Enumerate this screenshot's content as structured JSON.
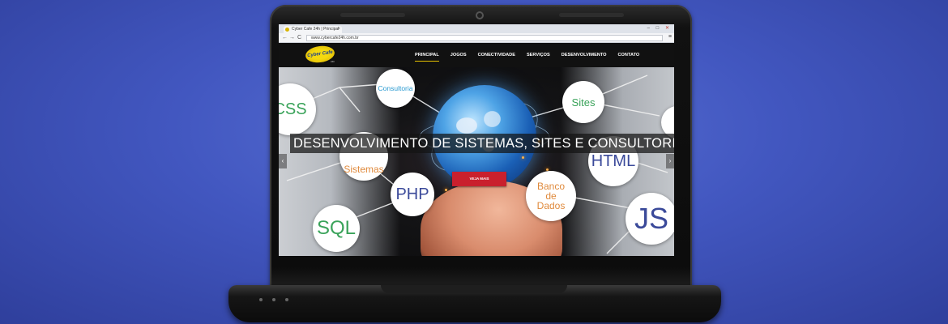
{
  "browser": {
    "tab_title": "Cyber Cafe 24h | Principal",
    "tab_close": "×",
    "url": "www.cybercafe24h.com.br",
    "back": "←",
    "forward": "→",
    "reload": "C",
    "window_controls": [
      "–",
      "□",
      "✕"
    ],
    "menu": "≡"
  },
  "site": {
    "logo_text": "Cyber Cafe",
    "logo_sub": "24h",
    "nav": [
      "PRINCIPAL",
      "JOGOS",
      "CONECTIVIDADE",
      "SERVIÇOS",
      "DESENVOLVIMENTO",
      "CONTATO"
    ],
    "active_nav": "PRINCIPAL",
    "accent": "#e6c200"
  },
  "hero": {
    "caption": "DESENVOLVIMENTO DE SISTEMAS, SITES E CONSULTORIAS",
    "cta_label": "VEJA MAIS",
    "cta_color": "#c9202d",
    "prev_arrow": "‹",
    "next_arrow": "›",
    "bubbles": {
      "css": "CSS",
      "consultoria": "Consultoria",
      "sites": "Sites",
      "sistemas": "Sistemas",
      "html": "HTML",
      "php": "PHP",
      "banco": "Banco de Dados",
      "sql": "SQL",
      "js": "JS"
    },
    "bubble_colors": {
      "green": "#3aa35a",
      "blue": "#2b9bd1",
      "navy": "#3b4a9a",
      "orange": "#e08a3c"
    }
  }
}
